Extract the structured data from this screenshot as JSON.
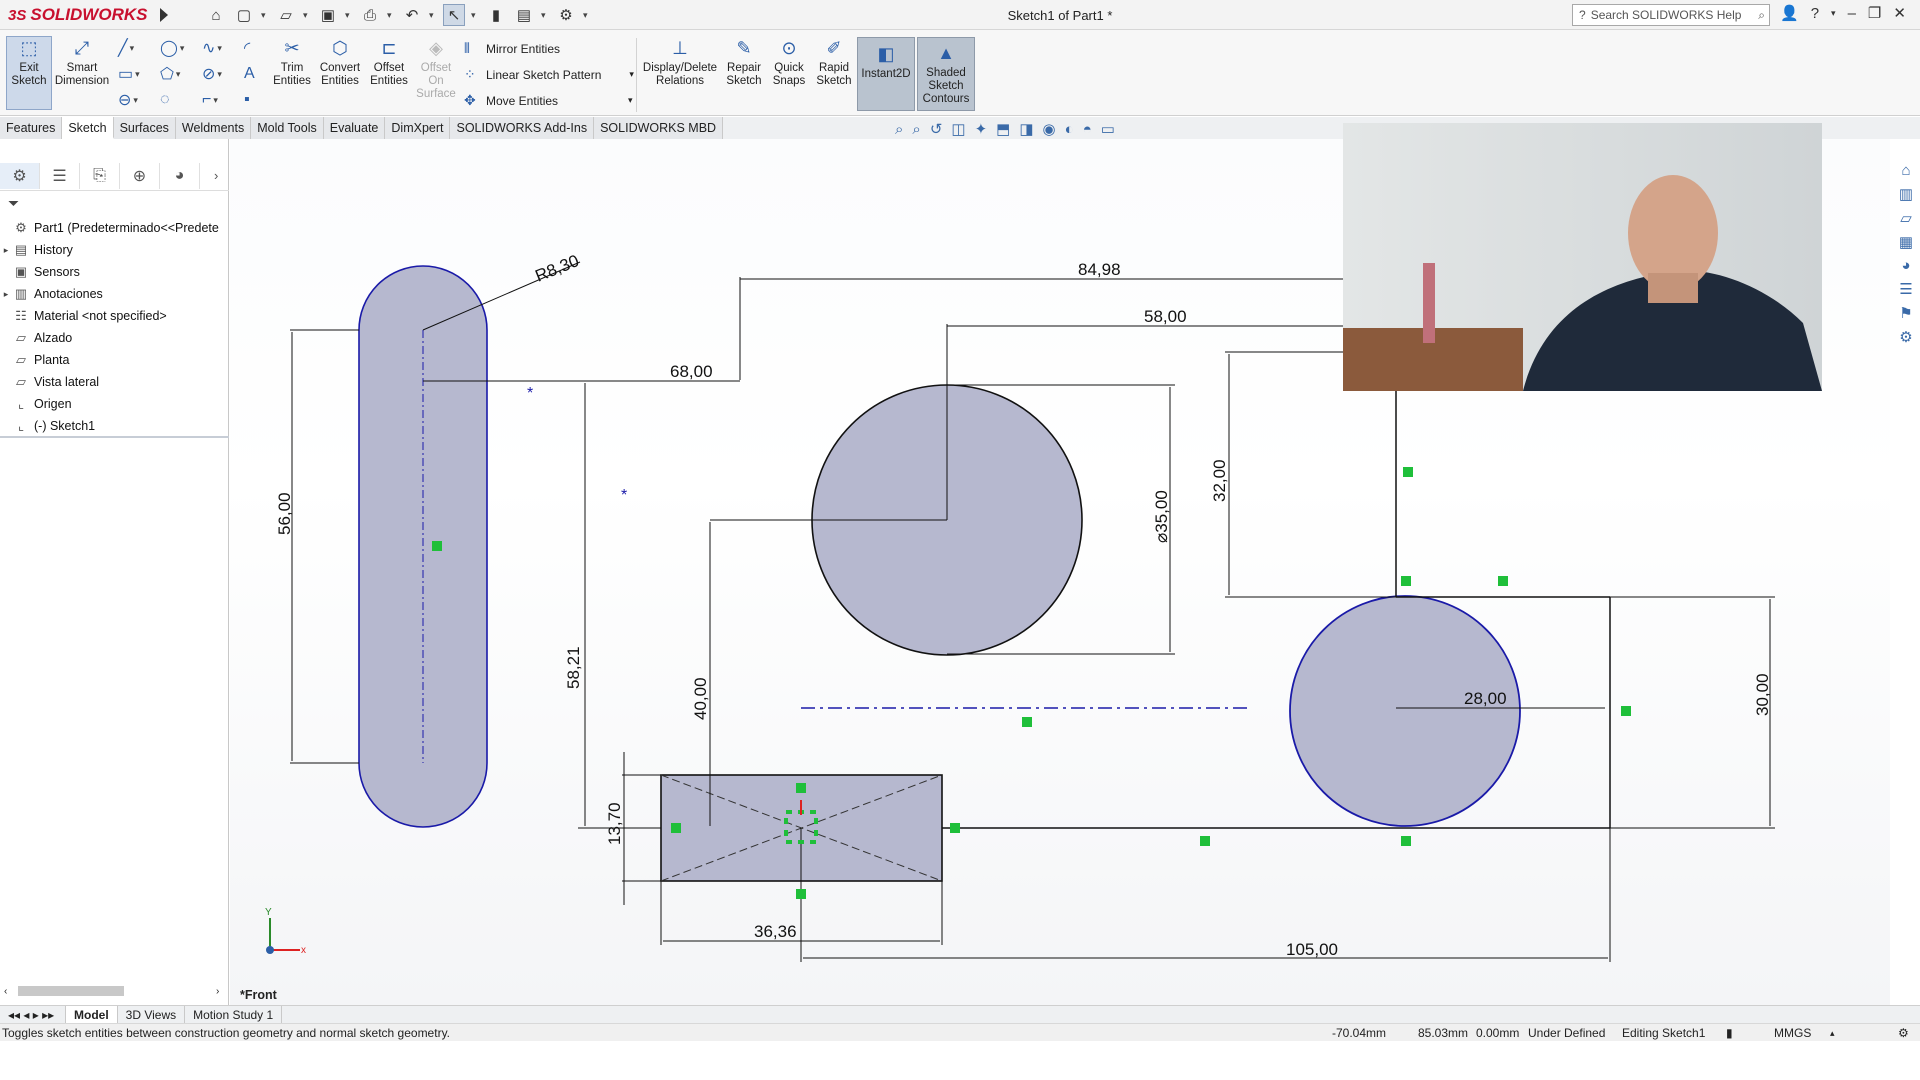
{
  "app": {
    "brand": "SOLIDWORKS",
    "ds_mark": "3S",
    "document_title": "Sketch1 of Part1 *"
  },
  "search": {
    "placeholder": "Search SOLIDWORKS Help"
  },
  "ribbon": {
    "exit_sketch": "Exit Sketch",
    "smart_dimension": "Smart Dimension",
    "trim_entities": "Trim Entities",
    "convert_entities": "Convert Entities",
    "offset_entities": "Offset Entities",
    "offset_on_surface": "Offset On Surface",
    "mirror_entities": "Mirror Entities",
    "linear_sketch_pattern": "Linear Sketch Pattern",
    "move_entities": "Move Entities",
    "display_delete_relations": "Display/Delete Relations",
    "repair_sketch": "Repair Sketch",
    "quick_snaps": "Quick Snaps",
    "rapid_sketch": "Rapid Sketch",
    "instant2d": "Instant2D",
    "shaded_sketch_contours": "Shaded Sketch Contours"
  },
  "tabs": [
    "Features",
    "Sketch",
    "Surfaces",
    "Weldments",
    "Mold Tools",
    "Evaluate",
    "DimXpert",
    "SOLIDWORKS Add-Ins",
    "SOLIDWORKS MBD"
  ],
  "active_tab": "Sketch",
  "tree": {
    "part": "Part1  (Predeterminado<<Predete",
    "items": [
      "History",
      "Sensors",
      "Anotaciones",
      "Material <not specified>",
      "Alzado",
      "Planta",
      "Vista lateral",
      "Origen",
      "(-) Sketch1"
    ]
  },
  "view_label": "*Front",
  "sketch": {
    "dims": {
      "r830": "R8,30",
      "d8498": "84,98",
      "d5800": "58,00",
      "d6800": "68,00",
      "d5600": "56,00",
      "dia3500": "⌀35,00",
      "d3200": "32,00",
      "d5821": "58,21",
      "d4000": "40,00",
      "d2800": "28,00",
      "d3000": "30,00",
      "d1370": "13,70",
      "d3636": "36,36",
      "d10500": "105,00"
    },
    "triad": {
      "x": "x",
      "y": "Y"
    }
  },
  "bottom_tabs": [
    "Model",
    "3D Views",
    "Motion Study 1"
  ],
  "active_bottom_tab": "Model",
  "status": {
    "message": "Toggles sketch entities between construction geometry and normal sketch geometry.",
    "x": "-70.04mm",
    "y": "85.03mm",
    "z": "0.00mm",
    "state": "Under Defined",
    "editing": "Editing Sketch1",
    "units": "MMGS"
  },
  "colors": {
    "sketch_fill": "#b6b8cf",
    "sketch_blue": "#1a1aa8",
    "relation_green": "#1fbf3a",
    "brand_red": "#c8102e"
  }
}
